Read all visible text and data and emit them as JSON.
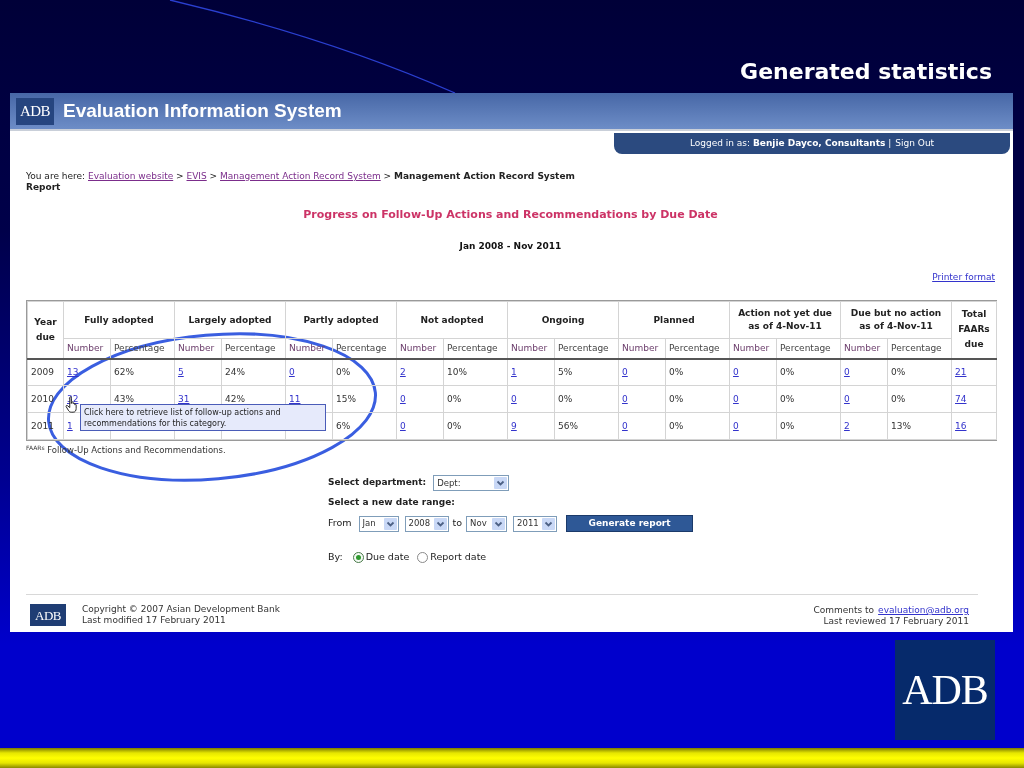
{
  "slide": {
    "title": "Generated statistics",
    "logo": "ADB"
  },
  "app": {
    "logo": "ADB",
    "title": "Evaluation Information System",
    "login": "Logged in as: **Benjie Dayco, Consultants** |",
    "sign_out": "Sign Out"
  },
  "breadcrumb": {
    "prefix": "You are here:",
    "items": [
      {
        "kind": "link",
        "label": "Evaluation website"
      },
      {
        "kind": "separator",
        "label": ">"
      },
      {
        "kind": "link",
        "label": "EVIS"
      },
      {
        "kind": "separator",
        "label": ">"
      },
      {
        "kind": "link",
        "label": "Management Action Record System"
      },
      {
        "kind": "separator",
        "label": ">"
      },
      {
        "kind": "current",
        "label": "Management Action Record System Report"
      }
    ]
  },
  "report": {
    "title": "Progress on Follow-Up Actions and Recommendations by Due Date",
    "period": "Jan 2008 - Nov 2011",
    "printer_link": "Printer format"
  },
  "table": {
    "year_header": "Year due",
    "groups": [
      {
        "label": "Fully adopted",
        "subcolumns": [
          "Number",
          "Percentage"
        ]
      },
      {
        "label": "Largely adopted",
        "subcolumns": [
          "Number",
          "Percentage"
        ]
      },
      {
        "label": "Partly adopted",
        "subcolumns": [
          "Number",
          "Percentage"
        ]
      },
      {
        "label": "Not adopted",
        "subcolumns": [
          "Number",
          "Percentage"
        ]
      },
      {
        "label": "Ongoing",
        "subcolumns": [
          "Number",
          "Percentage"
        ]
      },
      {
        "label": "Planned",
        "subcolumns": [
          "Number",
          "Percentage"
        ]
      },
      {
        "label": "Action not yet due as of 4-Nov-11",
        "subcolumns": [
          "Number",
          "Percentage"
        ]
      },
      {
        "label": "Due but no action as of 4-Nov-11",
        "subcolumns": [
          "Number",
          "Percentage"
        ]
      }
    ],
    "total_header": "Total FAARs due",
    "rows": [
      {
        "year": "2009",
        "cells": [
          {
            "text": "13",
            "kind": "link"
          },
          {
            "text": "62%",
            "kind": "plain"
          },
          {
            "text": "5",
            "kind": "link"
          },
          {
            "text": "24%",
            "kind": "plain"
          },
          {
            "text": "0",
            "kind": "link"
          },
          {
            "text": "0%",
            "kind": "plain"
          },
          {
            "text": "2",
            "kind": "link"
          },
          {
            "text": "10%",
            "kind": "plain"
          },
          {
            "text": "1",
            "kind": "link"
          },
          {
            "text": "5%",
            "kind": "plain"
          },
          {
            "text": "0",
            "kind": "link"
          },
          {
            "text": "0%",
            "kind": "plain"
          },
          {
            "text": "0",
            "kind": "link"
          },
          {
            "text": "0%",
            "kind": "plain"
          },
          {
            "text": "0",
            "kind": "link"
          },
          {
            "text": "0%",
            "kind": "plain"
          }
        ],
        "total": {
          "text": "21",
          "kind": "link"
        }
      },
      {
        "year": "2010",
        "cells": [
          {
            "text": "32",
            "kind": "link"
          },
          {
            "text": "43%",
            "kind": "plain"
          },
          {
            "text": "31",
            "kind": "link"
          },
          {
            "text": "42%",
            "kind": "plain"
          },
          {
            "text": "11",
            "kind": "link"
          },
          {
            "text": "15%",
            "kind": "plain"
          },
          {
            "text": "0",
            "kind": "link"
          },
          {
            "text": "0%",
            "kind": "plain"
          },
          {
            "text": "0",
            "kind": "link"
          },
          {
            "text": "0%",
            "kind": "plain"
          },
          {
            "text": "0",
            "kind": "link"
          },
          {
            "text": "0%",
            "kind": "plain"
          },
          {
            "text": "0",
            "kind": "link"
          },
          {
            "text": "0%",
            "kind": "plain"
          },
          {
            "text": "0",
            "kind": "link"
          },
          {
            "text": "0%",
            "kind": "plain"
          }
        ],
        "total": {
          "text": "74",
          "kind": "link"
        }
      },
      {
        "year": "2011",
        "cells": [
          {
            "text": "1",
            "kind": "link"
          },
          null,
          null,
          null,
          null,
          {
            "text": "6%",
            "kind": "plain"
          },
          {
            "text": "0",
            "kind": "link"
          },
          {
            "text": "0%",
            "kind": "plain"
          },
          {
            "text": "9",
            "kind": "link"
          },
          {
            "text": "56%",
            "kind": "plain"
          },
          {
            "text": "0",
            "kind": "link"
          },
          {
            "text": "0%",
            "kind": "plain"
          },
          {
            "text": "0",
            "kind": "link"
          },
          {
            "text": "0%",
            "kind": "plain"
          },
          {
            "text": "2",
            "kind": "link"
          },
          {
            "text": "13%",
            "kind": "plain"
          }
        ],
        "total": {
          "text": "16",
          "kind": "link"
        }
      }
    ]
  },
  "footnote": "$^{FAARs}$ Follow-Up Actions and Recommendations.",
  "tooltip": "Click here to retrieve list of follow-up actions and recommendations for this category.",
  "annotation": {
    "kind": "ellipse"
  },
  "cursor": {
    "kind": "hand"
  },
  "form": {
    "department_label": "Select department:",
    "department": "Dept:",
    "range_label": "Select a new date range:",
    "from_label": "From",
    "from_month": "Jan",
    "from_year": "2008",
    "to_label": "to",
    "to_month": "Nov",
    "to_year": "2011",
    "button": "Generate report",
    "by_label": "By:",
    "by_options": [
      {
        "label": "Due date",
        "selected": true
      },
      {
        "label": "Report date",
        "selected": false
      }
    ]
  },
  "footer": {
    "logo": "ADB",
    "copyright": "Copyright © 2007 Asian Development Bank",
    "modified": "Last modified 17 February 2011",
    "comments": "Comments to",
    "email": "evaluation@adb.org",
    "reviewed": "Last reviewed 17 February 2011"
  }
}
